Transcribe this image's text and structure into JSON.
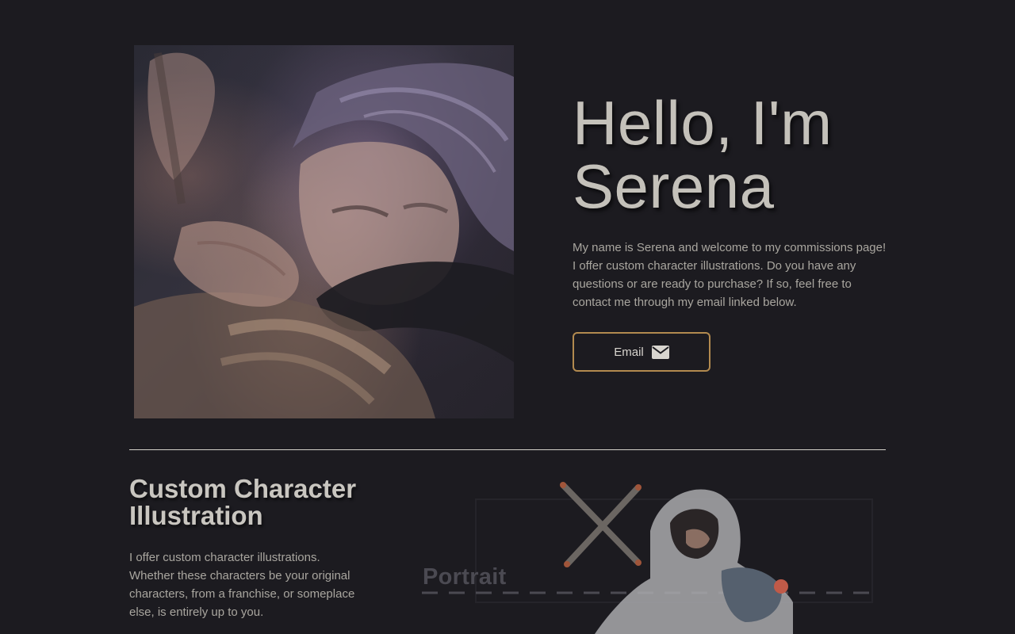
{
  "hero": {
    "title": "Hello, I'm Serena",
    "description": "My name is Serena and welcome to my commissions page! I offer custom character illustrations. Do you have any questions or are ready to purchase? If so, feel free to contact me through my email linked below.",
    "email_button_label": "Email",
    "email_icon": "envelope-icon",
    "accent_color": "#b28a4f"
  },
  "section": {
    "title": "Custom Character Illustration",
    "description": "I offer custom character illustrations. Whether these characters be your original characters, from a franchise, or someplace else, is entirely up to you.",
    "showcase_label": "Portrait"
  }
}
